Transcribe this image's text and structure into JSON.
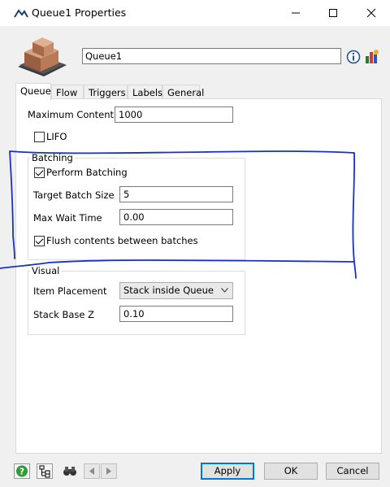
{
  "window": {
    "title": "Queue1  Properties",
    "icons": {
      "app": "flexsim-icon",
      "minimize": "minimize-icon",
      "maximize": "maximize-icon",
      "close": "close-icon"
    }
  },
  "header": {
    "object_name": "Queue1",
    "icons": {
      "object": "queue-box-icon",
      "info": "info-icon",
      "chart": "chart-icon"
    }
  },
  "tabs": [
    {
      "label": "Queue",
      "active": true
    },
    {
      "label": "Flow",
      "active": false
    },
    {
      "label": "Triggers",
      "active": false
    },
    {
      "label": "Labels",
      "active": false
    },
    {
      "label": "General",
      "active": false
    }
  ],
  "queue_tab": {
    "max_content_label": "Maximum Content",
    "max_content_value": "1000",
    "lifo_label": "LIFO",
    "lifo_checked": false,
    "batching": {
      "title": "Batching",
      "perform_batching_label": "Perform Batching",
      "perform_batching_checked": true,
      "target_batch_size_label": "Target Batch Size",
      "target_batch_size_value": "5",
      "max_wait_time_label": "Max Wait Time",
      "max_wait_time_value": "0.00",
      "flush_label": "Flush contents between batches",
      "flush_checked": true
    },
    "visual": {
      "title": "Visual",
      "item_placement_label": "Item Placement",
      "item_placement_value": "Stack inside Queue",
      "stack_base_z_label": "Stack Base Z",
      "stack_base_z_value": "0.10"
    }
  },
  "footer": {
    "icons": {
      "help": "help-icon",
      "tree": "tree-view-icon",
      "find": "binoculars-icon",
      "prev": "prev-arrow-icon",
      "next": "next-arrow-icon"
    },
    "apply_label": "Apply",
    "ok_label": "OK",
    "cancel_label": "Cancel"
  },
  "colors": {
    "accent": "#0078d7",
    "annotation": "#1a2fd0"
  }
}
